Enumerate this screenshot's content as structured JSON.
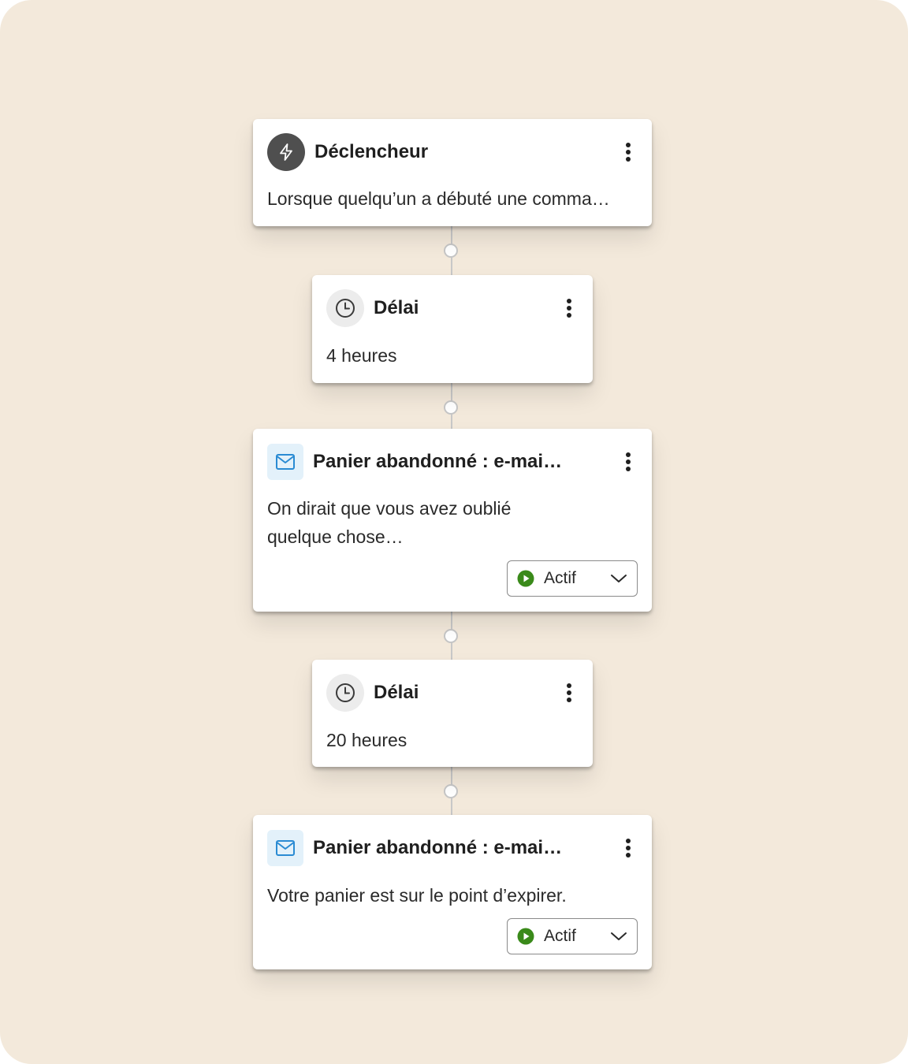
{
  "colors": {
    "background": "#f3e9db",
    "trigger_icon_bg": "#4f4f4f",
    "delay_icon_bg": "#ececec",
    "email_icon_bg": "#e3f1fa",
    "email_icon_stroke": "#2a8bd3",
    "status_active": "#3a8a1a"
  },
  "steps": [
    {
      "type": "trigger",
      "icon": "lightning-icon",
      "title": "Déclencheur",
      "description": "Lorsque quelqu’un a débuté une comma…"
    },
    {
      "type": "delay",
      "icon": "clock-icon",
      "title": "Délai",
      "description": "4 heures"
    },
    {
      "type": "email",
      "icon": "mail-icon",
      "title": "Panier abandonné : e-mai…",
      "description_lines": [
        "On dirait que vous avez oublié",
        "quelque chose…"
      ],
      "status": "Actif"
    },
    {
      "type": "delay",
      "icon": "clock-icon",
      "title": "Délai",
      "description": "20 heures"
    },
    {
      "type": "email",
      "icon": "mail-icon",
      "title": "Panier abandonné : e-mai…",
      "description": "Votre panier est sur le point d’expirer.",
      "status": "Actif"
    }
  ]
}
